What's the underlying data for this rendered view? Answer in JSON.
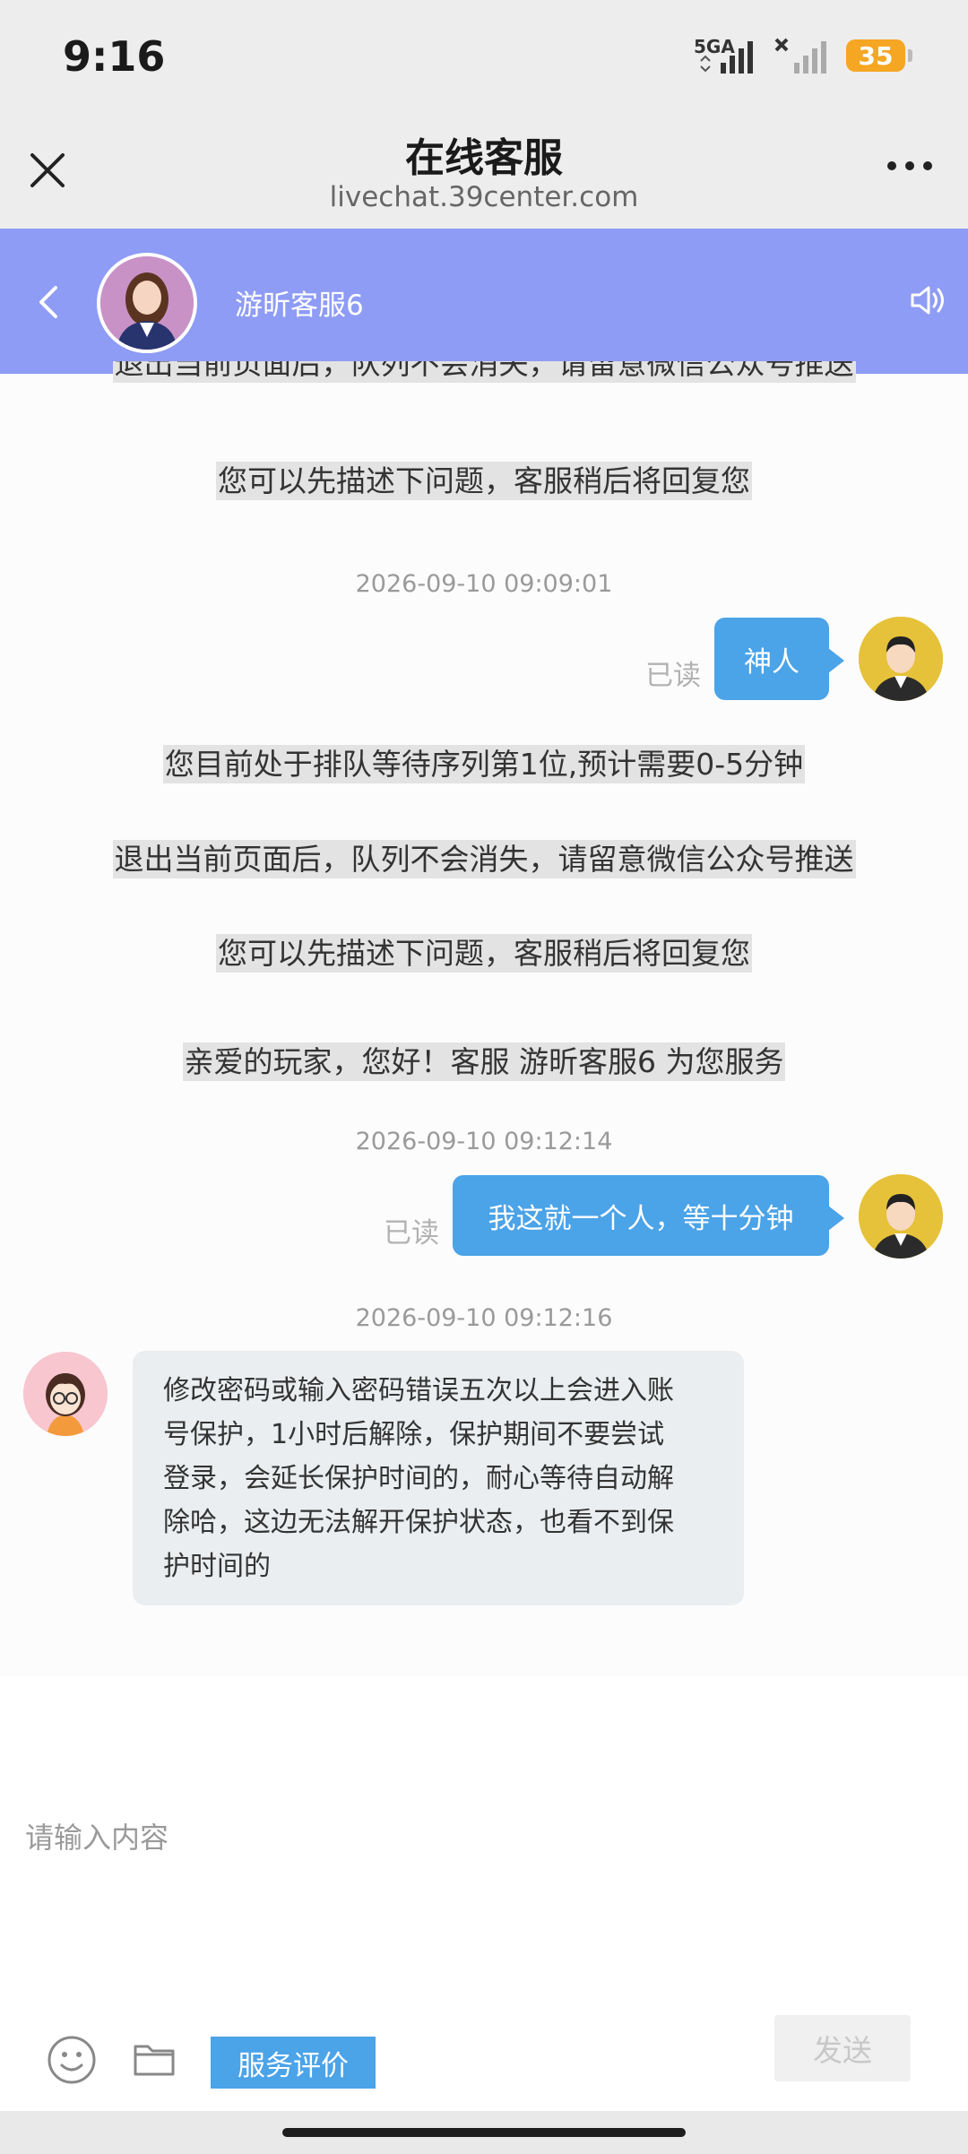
{
  "status_bar": {
    "time": "9:16",
    "network": "5GA",
    "battery": "35"
  },
  "browser": {
    "title": "在线客服",
    "url": "livechat.39center.com"
  },
  "chat_header": {
    "agent_name": "游昕客服6"
  },
  "messages": {
    "sys_top_cut": "退出当前页面后，队列不会消失，请留意微信公众号推送",
    "sys_1": "您可以先描述下问题，客服稍后将回复您",
    "ts_1": "2026-09-10 09:09:01",
    "out_1": "神人",
    "read_1": "已读",
    "sys_2": "您目前处于排队等待序列第1位,预计需要0-5分钟",
    "sys_3": "退出当前页面后，队列不会消失，请留意微信公众号推送",
    "sys_4": "您可以先描述下问题，客服稍后将回复您",
    "sys_5": "亲爱的玩家，您好！客服 游昕客服6 为您服务",
    "ts_2": "2026-09-10 09:12:14",
    "out_2": "我这就一个人，等十分钟",
    "read_2": "已读",
    "ts_3": "2026-09-10 09:12:16",
    "in_1_lines": [
      "修改密码或输入密码错误五次以上会进入账",
      "号保护，1小时后解除，保护期间不要尝试",
      "登录，会延长保护时间的，耐心等待自动解",
      "除哈，这边无法解开保护状态，也看不到保",
      "护时间的"
    ]
  },
  "composer": {
    "placeholder": "请输入内容",
    "rate_label": "服务评价",
    "send_label": "发送"
  },
  "colors": {
    "header_bg": "#8e9cf5",
    "bubble_out": "#4ba3e8",
    "bubble_in": "#eaeef0",
    "battery": "#f5a623"
  },
  "icons": [
    "close-icon",
    "more-icon",
    "back-icon",
    "speaker-icon",
    "emoji-icon",
    "folder-icon"
  ]
}
